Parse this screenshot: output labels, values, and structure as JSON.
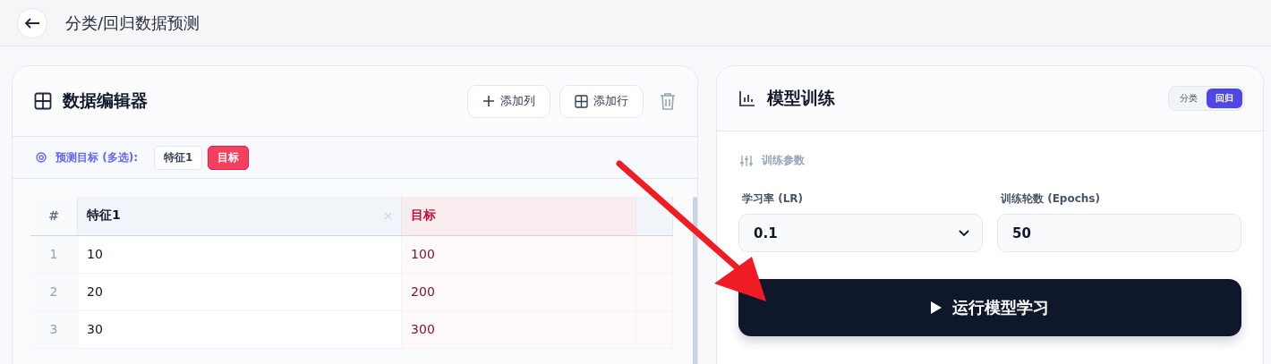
{
  "header": {
    "title": "分类/回归数据预测"
  },
  "editor": {
    "title": "数据编辑器",
    "buttons": [
      {
        "label": "添加列",
        "kind": "add"
      },
      {
        "label": "添加行",
        "kind": "table"
      }
    ],
    "target_label": "预测目标 (多选):",
    "targets": [
      {
        "label": "特征1",
        "selected": false
      },
      {
        "label": "目标",
        "selected": true
      }
    ],
    "table": {
      "columns": [
        {
          "label": "#",
          "kind": "index"
        },
        {
          "label": "特征1",
          "kind": "feature",
          "target": false
        },
        {
          "label": "目标",
          "kind": "feature",
          "target": true
        }
      ],
      "rows": [
        [
          "1",
          "10",
          "100"
        ],
        [
          "2",
          "20",
          "200"
        ],
        [
          "3",
          "30",
          "300"
        ]
      ]
    }
  },
  "training": {
    "title": "模型训练",
    "modes": [
      {
        "label": "分类",
        "selected": false
      },
      {
        "label": "回归",
        "selected": true
      }
    ],
    "section": "训练参数",
    "fields": [
      {
        "label": "学习率 (LR)",
        "kind": "select",
        "value": "0.1"
      },
      {
        "label": "训练轮数 (Epochs)",
        "kind": "input",
        "value": "50"
      }
    ],
    "run_button": "运行模型学习"
  }
}
